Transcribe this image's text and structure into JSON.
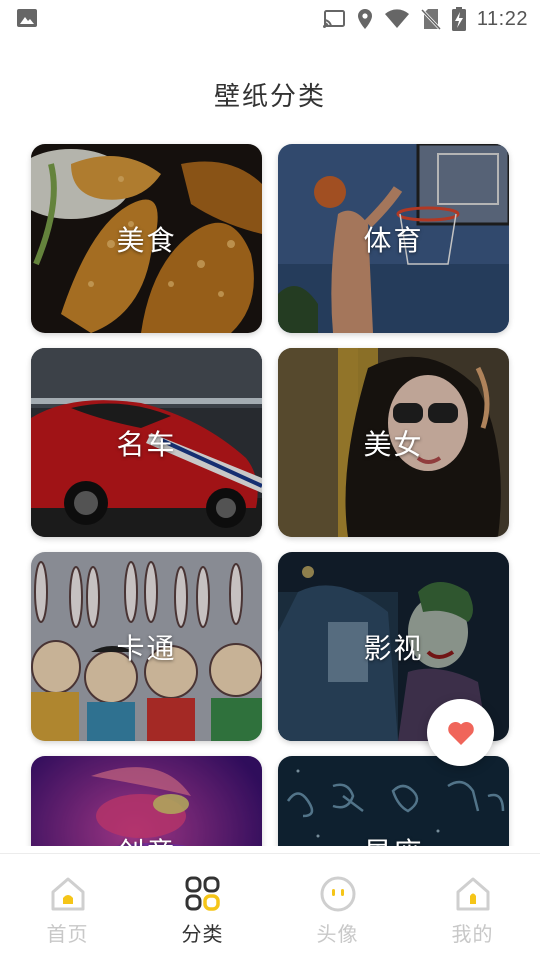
{
  "status_bar": {
    "time": "11:22",
    "left_icon": "image-notification-icon",
    "right_icons": [
      "cast-icon",
      "location-icon",
      "wifi-icon",
      "no-sim-icon",
      "battery-charging-icon"
    ]
  },
  "page": {
    "title": "壁纸分类"
  },
  "categories": [
    {
      "label": "美食"
    },
    {
      "label": "体育"
    },
    {
      "label": "名车"
    },
    {
      "label": "美女"
    },
    {
      "label": "卡通"
    },
    {
      "label": "影视"
    },
    {
      "label": "创意"
    },
    {
      "label": "星座"
    }
  ],
  "fab": {
    "icon": "heart-icon",
    "color": "#f0655a"
  },
  "bottom_nav": {
    "items": [
      {
        "label": "首页",
        "icon": "home-icon",
        "active": false
      },
      {
        "label": "分类",
        "icon": "category-grid-icon",
        "active": true
      },
      {
        "label": "头像",
        "icon": "avatar-face-icon",
        "active": false
      },
      {
        "label": "我的",
        "icon": "profile-home-icon",
        "active": false
      }
    ]
  },
  "colors": {
    "accent": "#f5c518",
    "nav_inactive": "#c8c8c8",
    "nav_active_text": "#333333",
    "heart": "#f0655a"
  }
}
